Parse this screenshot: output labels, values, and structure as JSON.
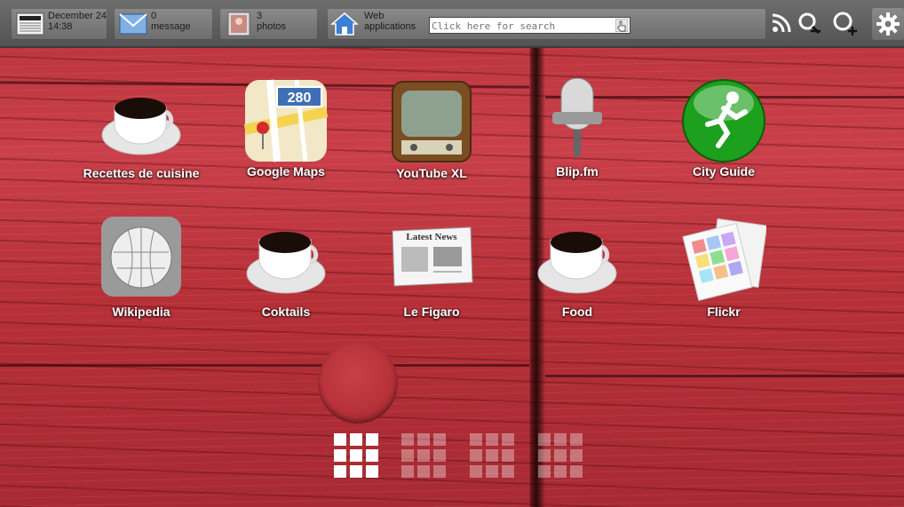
{
  "topbar": {
    "news": {
      "date": "December 24",
      "time": "14:38",
      "icon": "newspaper-icon"
    },
    "messages": {
      "count": "0",
      "label": "message",
      "icon": "envelope-icon"
    },
    "photos": {
      "count": "3",
      "label": "photos",
      "icon": "photo-icon"
    },
    "webapps": {
      "line1": "Web",
      "line2": "applications",
      "icon": "home-icon"
    },
    "search": {
      "placeholder": "Click here for search"
    },
    "right_icons": [
      "rss-icon",
      "zoom-out-icon",
      "zoom-in-icon",
      "gear-icon"
    ]
  },
  "apps": [
    {
      "label": "Recettes de cuisine",
      "icon": "coffee-cup-icon"
    },
    {
      "label": "Google Maps",
      "icon": "maps-icon"
    },
    {
      "label": "YouTube XL",
      "icon": "tv-icon"
    },
    {
      "label": "Blip.fm",
      "icon": "microphone-icon"
    },
    {
      "label": "City Guide",
      "icon": "runner-icon"
    },
    {
      "label": "Wikipedia",
      "icon": "wikipedia-globe-icon"
    },
    {
      "label": "Coktails",
      "icon": "coffee-cup-icon"
    },
    {
      "label": "Le Figaro",
      "icon": "newspaper-icon"
    },
    {
      "label": "Food",
      "icon": "coffee-cup-icon"
    },
    {
      "label": "Flickr",
      "icon": "photo-stack-icon"
    }
  ],
  "map_badge": "280",
  "newspaper_headline": "Latest News",
  "pages": {
    "total": 4,
    "current": 1
  },
  "colors": {
    "accent": "#b8323a",
    "toolbar": "#5e5e5e"
  }
}
